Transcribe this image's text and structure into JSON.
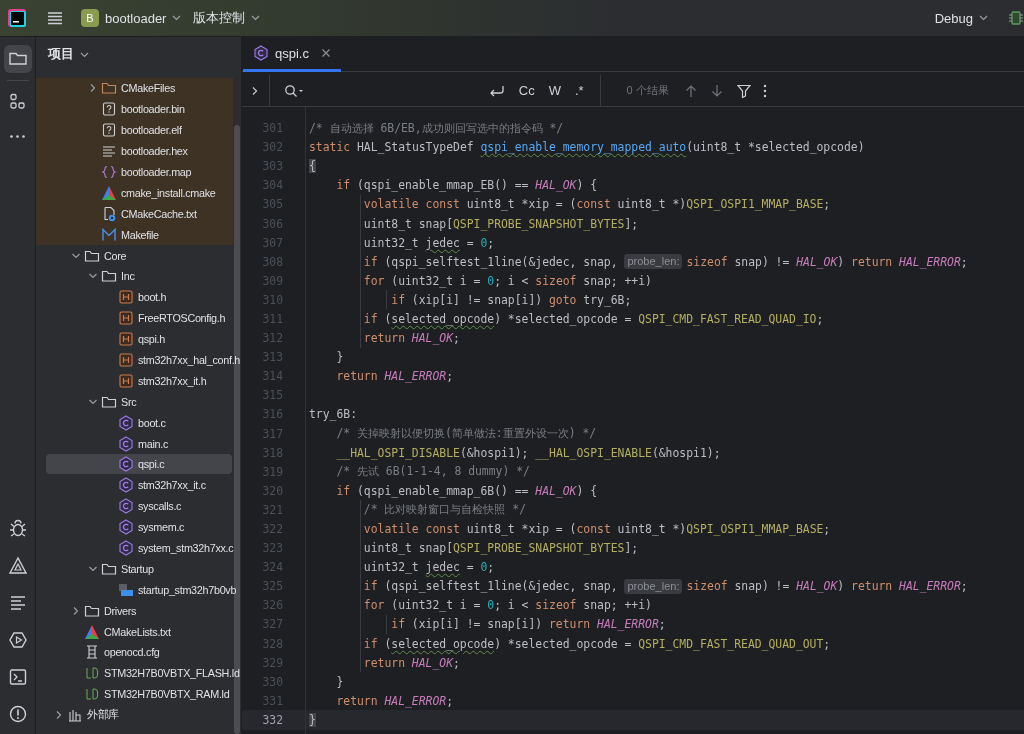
{
  "top_bar": {
    "project_badge": "B",
    "project_name": "bootloader",
    "vcs_menu": "版本控制",
    "run_config": "Debug"
  },
  "tool_windows": [
    {
      "kind": "project",
      "selected": true
    },
    {
      "kind": "structure",
      "selected": false
    },
    {
      "kind": "more",
      "selected": false
    },
    {
      "kind": "debug",
      "selected": false
    },
    {
      "kind": "problems",
      "selected": false
    },
    {
      "kind": "log",
      "selected": false
    },
    {
      "kind": "services",
      "selected": false
    },
    {
      "kind": "terminal",
      "selected": false
    },
    {
      "kind": "alert",
      "selected": false
    }
  ],
  "project_panel": {
    "title": "项目",
    "tree": [
      {
        "children": [
          {
            "children": [
              {
                "label": "CMakeFiles",
                "kind": "folder",
                "expanded": false,
                "excluded": true,
                "selected": false
              },
              {
                "label": "bootloader.bin",
                "kind": "unknown",
                "excluded": true,
                "selected": false
              },
              {
                "label": "bootloader.elf",
                "kind": "unknown",
                "excluded": true,
                "selected": false
              },
              {
                "label": "bootloader.hex",
                "kind": "text",
                "excluded": true,
                "selected": false
              },
              {
                "label": "bootloader.map",
                "kind": "map",
                "excluded": true,
                "selected": false
              },
              {
                "label": "cmake_install.cmake",
                "kind": "cmake",
                "excluded": true,
                "selected": false
              },
              {
                "label": "CMakeCache.txt",
                "kind": "cache",
                "excluded": true,
                "selected": false
              },
              {
                "label": "Makefile",
                "kind": "makefile",
                "excluded": true,
                "selected": false
              }
            ]
          },
          {
            "label": "Core",
            "kind": "folder",
            "expanded": true,
            "selected": false,
            "children": [
              {
                "label": "Inc",
                "kind": "folder",
                "expanded": true,
                "selected": false,
                "children": [
                  {
                    "label": "boot.h",
                    "kind": "header",
                    "selected": false
                  },
                  {
                    "label": "FreeRTOSConfig.h",
                    "kind": "header",
                    "selected": false
                  },
                  {
                    "label": "qspi.h",
                    "kind": "header",
                    "selected": false
                  },
                  {
                    "label": "stm32h7xx_hal_conf.h",
                    "kind": "header",
                    "selected": false
                  },
                  {
                    "label": "stm32h7xx_it.h",
                    "kind": "header",
                    "selected": false
                  }
                ]
              },
              {
                "label": "Src",
                "kind": "folder",
                "expanded": true,
                "selected": false,
                "children": [
                  {
                    "label": "boot.c",
                    "kind": "c",
                    "selected": false
                  },
                  {
                    "label": "main.c",
                    "kind": "c",
                    "selected": false
                  },
                  {
                    "label": "qspi.c",
                    "kind": "c",
                    "selected": true
                  },
                  {
                    "label": "stm32h7xx_it.c",
                    "kind": "c",
                    "selected": false
                  },
                  {
                    "label": "syscalls.c",
                    "kind": "c",
                    "selected": false
                  },
                  {
                    "label": "sysmem.c",
                    "kind": "c",
                    "selected": false
                  },
                  {
                    "label": "system_stm32h7xx.c",
                    "kind": "c",
                    "selected": false
                  }
                ]
              },
              {
                "label": "Startup",
                "kind": "folder",
                "expanded": true,
                "selected": false,
                "children": [
                  {
                    "label": "startup_stm32h7b0vb",
                    "kind": "asm",
                    "selected": false
                  }
                ]
              }
            ]
          },
          {
            "label": "Drivers",
            "kind": "folder",
            "expanded": false,
            "selected": false
          },
          {
            "label": "CMakeLists.txt",
            "kind": "cmake",
            "selected": false
          },
          {
            "label": "openocd.cfg",
            "kind": "cfg",
            "selected": false
          },
          {
            "label": "STM32H7B0VBTX_FLASH.ld",
            "kind": "ld",
            "selected": false
          },
          {
            "label": "STM32H7B0VBTX_RAM.ld",
            "kind": "ld",
            "selected": false
          }
        ]
      },
      {
        "label": "外部库",
        "kind": "library",
        "expanded": false,
        "selected": false
      }
    ]
  },
  "editor": {
    "tabs": [
      {
        "label": "qspi.c",
        "kind": "c",
        "selected": true
      }
    ],
    "find_bar": {
      "toggles": [
        "Cc",
        "W",
        ".*"
      ],
      "result_count": "0 个结果"
    },
    "lines": [
      {
        "number": "301",
        "current": false,
        "tokens": [
          {
            "kind": "comment",
            "text": "/* 自动选择 6B/EB,成功则回写选中的指令码 */"
          }
        ]
      },
      {
        "number": "302",
        "current": false,
        "tokens": [
          {
            "kind": "kw",
            "text": "static"
          },
          {
            "kind": "plain",
            "text": " HAL_StatusTypeDef "
          },
          {
            "kind": "decl",
            "text": "qspi_enable_memory_mapped_auto"
          },
          {
            "kind": "plain",
            "text": "(uint8_t *selected_opcode)"
          }
        ]
      },
      {
        "number": "303",
        "current": false,
        "tokens": [
          {
            "kind": "match",
            "text": "{"
          }
        ]
      },
      {
        "number": "304",
        "current": false,
        "tokens": [
          {
            "kind": "kw",
            "text": "    if"
          },
          {
            "kind": "plain",
            "text": " (qspi_enable_mmap_EB() == "
          },
          {
            "kind": "enum",
            "text": "HAL_OK"
          },
          {
            "kind": "plain",
            "text": ") {"
          }
        ]
      },
      {
        "number": "305",
        "current": false,
        "tokens": [
          {
            "kind": "kw",
            "text": "        volatile const"
          },
          {
            "kind": "plain",
            "text": " uint8_t *xip = ("
          },
          {
            "kind": "kw",
            "text": "const"
          },
          {
            "kind": "plain",
            "text": " uint8_t *)"
          },
          {
            "kind": "macro",
            "text": "QSPI_OSPI1_MMAP_BASE"
          },
          {
            "kind": "plain",
            "text": ";"
          }
        ]
      },
      {
        "number": "306",
        "current": false,
        "tokens": [
          {
            "kind": "plain",
            "text": "        uint8_t snap["
          },
          {
            "kind": "macro",
            "text": "QSPI_PROBE_SNAPSHOT_BYTES"
          },
          {
            "kind": "plain",
            "text": "];"
          }
        ]
      },
      {
        "number": "307",
        "current": false,
        "tokens": [
          {
            "kind": "plain",
            "text": "        uint32_t "
          },
          {
            "kind": "typo",
            "text": "jedec"
          },
          {
            "kind": "plain",
            "text": " = "
          },
          {
            "kind": "num",
            "text": "0"
          },
          {
            "kind": "plain",
            "text": ";"
          }
        ]
      },
      {
        "number": "308",
        "current": false,
        "tokens": [
          {
            "kind": "kw",
            "text": "        if"
          },
          {
            "kind": "plain",
            "text": " (qspi_selftest_1line(&jedec, snap, "
          },
          {
            "kind": "hint",
            "text": "probe_len:"
          },
          {
            "kind": "kw",
            "text": "sizeof"
          },
          {
            "kind": "plain",
            "text": " snap) != "
          },
          {
            "kind": "enum",
            "text": "HAL_OK"
          },
          {
            "kind": "plain",
            "text": ") "
          },
          {
            "kind": "kw",
            "text": "return"
          },
          {
            "kind": "enum",
            "text": " HAL_ERROR"
          },
          {
            "kind": "plain",
            "text": ";"
          }
        ]
      },
      {
        "number": "309",
        "current": false,
        "tokens": [
          {
            "kind": "kw",
            "text": "        for"
          },
          {
            "kind": "plain",
            "text": " (uint32_t i = "
          },
          {
            "kind": "num",
            "text": "0"
          },
          {
            "kind": "plain",
            "text": "; i < "
          },
          {
            "kind": "kw",
            "text": "sizeof"
          },
          {
            "kind": "plain",
            "text": " snap; ++i)"
          }
        ]
      },
      {
        "number": "310",
        "current": false,
        "tokens": [
          {
            "kind": "kw",
            "text": "            if"
          },
          {
            "kind": "plain",
            "text": " (xip[i] != snap[i]) "
          },
          {
            "kind": "kw",
            "text": "goto"
          },
          {
            "kind": "plain",
            "text": " try_6B;"
          }
        ]
      },
      {
        "number": "311",
        "current": false,
        "tokens": [
          {
            "kind": "kw",
            "text": "        if"
          },
          {
            "kind": "plain",
            "text": " ("
          },
          {
            "kind": "typo",
            "text": "selected_opcode"
          },
          {
            "kind": "plain",
            "text": ") *selected_opcode = "
          },
          {
            "kind": "macro",
            "text": "QSPI_CMD_FAST_READ_QUAD_IO"
          },
          {
            "kind": "plain",
            "text": ";"
          }
        ]
      },
      {
        "number": "312",
        "current": false,
        "tokens": [
          {
            "kind": "kw",
            "text": "        return"
          },
          {
            "kind": "enum",
            "text": " HAL_OK"
          },
          {
            "kind": "plain",
            "text": ";"
          }
        ]
      },
      {
        "number": "313",
        "current": false,
        "tokens": [
          {
            "kind": "plain",
            "text": "    }"
          }
        ]
      },
      {
        "number": "314",
        "current": false,
        "tokens": [
          {
            "kind": "kw",
            "text": "    return"
          },
          {
            "kind": "enum",
            "text": " HAL_ERROR"
          },
          {
            "kind": "plain",
            "text": ";"
          }
        ]
      },
      {
        "number": "315",
        "current": false
      },
      {
        "number": "316",
        "current": false,
        "tokens": [
          {
            "kind": "plain",
            "text": "try_6B:"
          }
        ]
      },
      {
        "number": "317",
        "current": false,
        "tokens": [
          {
            "kind": "comment",
            "text": "    /* 关掉映射以便切换(简单做法:重置外设一次) */"
          }
        ]
      },
      {
        "number": "318",
        "current": false,
        "tokens": [
          {
            "kind": "macro",
            "text": "    __HAL_OSPI_DISABLE"
          },
          {
            "kind": "plain",
            "text": "(&hospi1); "
          },
          {
            "kind": "macro",
            "text": "__HAL_OSPI_ENABLE"
          },
          {
            "kind": "plain",
            "text": "(&hospi1);"
          }
        ]
      },
      {
        "number": "319",
        "current": false,
        "tokens": [
          {
            "kind": "comment",
            "text": "    /* 先试 6B(1-1-4, 8 dummy) */"
          }
        ]
      },
      {
        "number": "320",
        "current": false,
        "tokens": [
          {
            "kind": "kw",
            "text": "    if"
          },
          {
            "kind": "plain",
            "text": " (qspi_enable_mmap_6B() == "
          },
          {
            "kind": "enum",
            "text": "HAL_OK"
          },
          {
            "kind": "plain",
            "text": ") {"
          }
        ]
      },
      {
        "number": "321",
        "current": false,
        "tokens": [
          {
            "kind": "comment",
            "text": "        /* 比对映射窗口与自检快照 */"
          }
        ]
      },
      {
        "number": "322",
        "current": false,
        "tokens": [
          {
            "kind": "kw",
            "text": "        volatile const"
          },
          {
            "kind": "plain",
            "text": " uint8_t *xip = ("
          },
          {
            "kind": "kw",
            "text": "const"
          },
          {
            "kind": "plain",
            "text": " uint8_t *)"
          },
          {
            "kind": "macro",
            "text": "QSPI_OSPI1_MMAP_BASE"
          },
          {
            "kind": "plain",
            "text": ";"
          }
        ]
      },
      {
        "number": "323",
        "current": false,
        "tokens": [
          {
            "kind": "plain",
            "text": "        uint8_t snap["
          },
          {
            "kind": "macro",
            "text": "QSPI_PROBE_SNAPSHOT_BYTES"
          },
          {
            "kind": "plain",
            "text": "];"
          }
        ]
      },
      {
        "number": "324",
        "current": false,
        "tokens": [
          {
            "kind": "plain",
            "text": "        uint32_t "
          },
          {
            "kind": "typo",
            "text": "jedec"
          },
          {
            "kind": "plain",
            "text": " = "
          },
          {
            "kind": "num",
            "text": "0"
          },
          {
            "kind": "plain",
            "text": ";"
          }
        ]
      },
      {
        "number": "325",
        "current": false,
        "tokens": [
          {
            "kind": "kw",
            "text": "        if"
          },
          {
            "kind": "plain",
            "text": " (qspi_selftest_1line(&jedec, snap, "
          },
          {
            "kind": "hint",
            "text": "probe_len:"
          },
          {
            "kind": "kw",
            "text": "sizeof"
          },
          {
            "kind": "plain",
            "text": " snap) != "
          },
          {
            "kind": "enum",
            "text": "HAL_OK"
          },
          {
            "kind": "plain",
            "text": ") "
          },
          {
            "kind": "kw",
            "text": "return"
          },
          {
            "kind": "enum",
            "text": " HAL_ERROR"
          },
          {
            "kind": "plain",
            "text": ";"
          }
        ]
      },
      {
        "number": "326",
        "current": false,
        "tokens": [
          {
            "kind": "kw",
            "text": "        for"
          },
          {
            "kind": "plain",
            "text": " (uint32_t i = "
          },
          {
            "kind": "num",
            "text": "0"
          },
          {
            "kind": "plain",
            "text": "; i < "
          },
          {
            "kind": "kw",
            "text": "sizeof"
          },
          {
            "kind": "plain",
            "text": " snap; ++i)"
          }
        ]
      },
      {
        "number": "327",
        "current": false,
        "tokens": [
          {
            "kind": "kw",
            "text": "            if"
          },
          {
            "kind": "plain",
            "text": " (xip[i] != snap[i]) "
          },
          {
            "kind": "kw",
            "text": "return"
          },
          {
            "kind": "enum",
            "text": " HAL_ERROR"
          },
          {
            "kind": "plain",
            "text": ";"
          }
        ]
      },
      {
        "number": "328",
        "current": false,
        "tokens": [
          {
            "kind": "kw",
            "text": "        if"
          },
          {
            "kind": "plain",
            "text": " ("
          },
          {
            "kind": "typo",
            "text": "selected_opcode"
          },
          {
            "kind": "plain",
            "text": ") *selected_opcode = "
          },
          {
            "kind": "macro",
            "text": "QSPI_CMD_FAST_READ_QUAD_OUT"
          },
          {
            "kind": "plain",
            "text": ";"
          }
        ]
      },
      {
        "number": "329",
        "current": false,
        "tokens": [
          {
            "kind": "kw",
            "text": "        return"
          },
          {
            "kind": "enum",
            "text": " HAL_OK"
          },
          {
            "kind": "plain",
            "text": ";"
          }
        ]
      },
      {
        "number": "330",
        "current": false,
        "tokens": [
          {
            "kind": "plain",
            "text": "    }"
          }
        ]
      },
      {
        "number": "331",
        "current": false,
        "tokens": [
          {
            "kind": "kw",
            "text": "    return"
          },
          {
            "kind": "enum",
            "text": " HAL_ERROR"
          },
          {
            "kind": "plain",
            "text": ";"
          }
        ]
      },
      {
        "number": "332",
        "current": true,
        "tokens": [
          {
            "kind": "match",
            "text": "}"
          }
        ]
      }
    ]
  }
}
